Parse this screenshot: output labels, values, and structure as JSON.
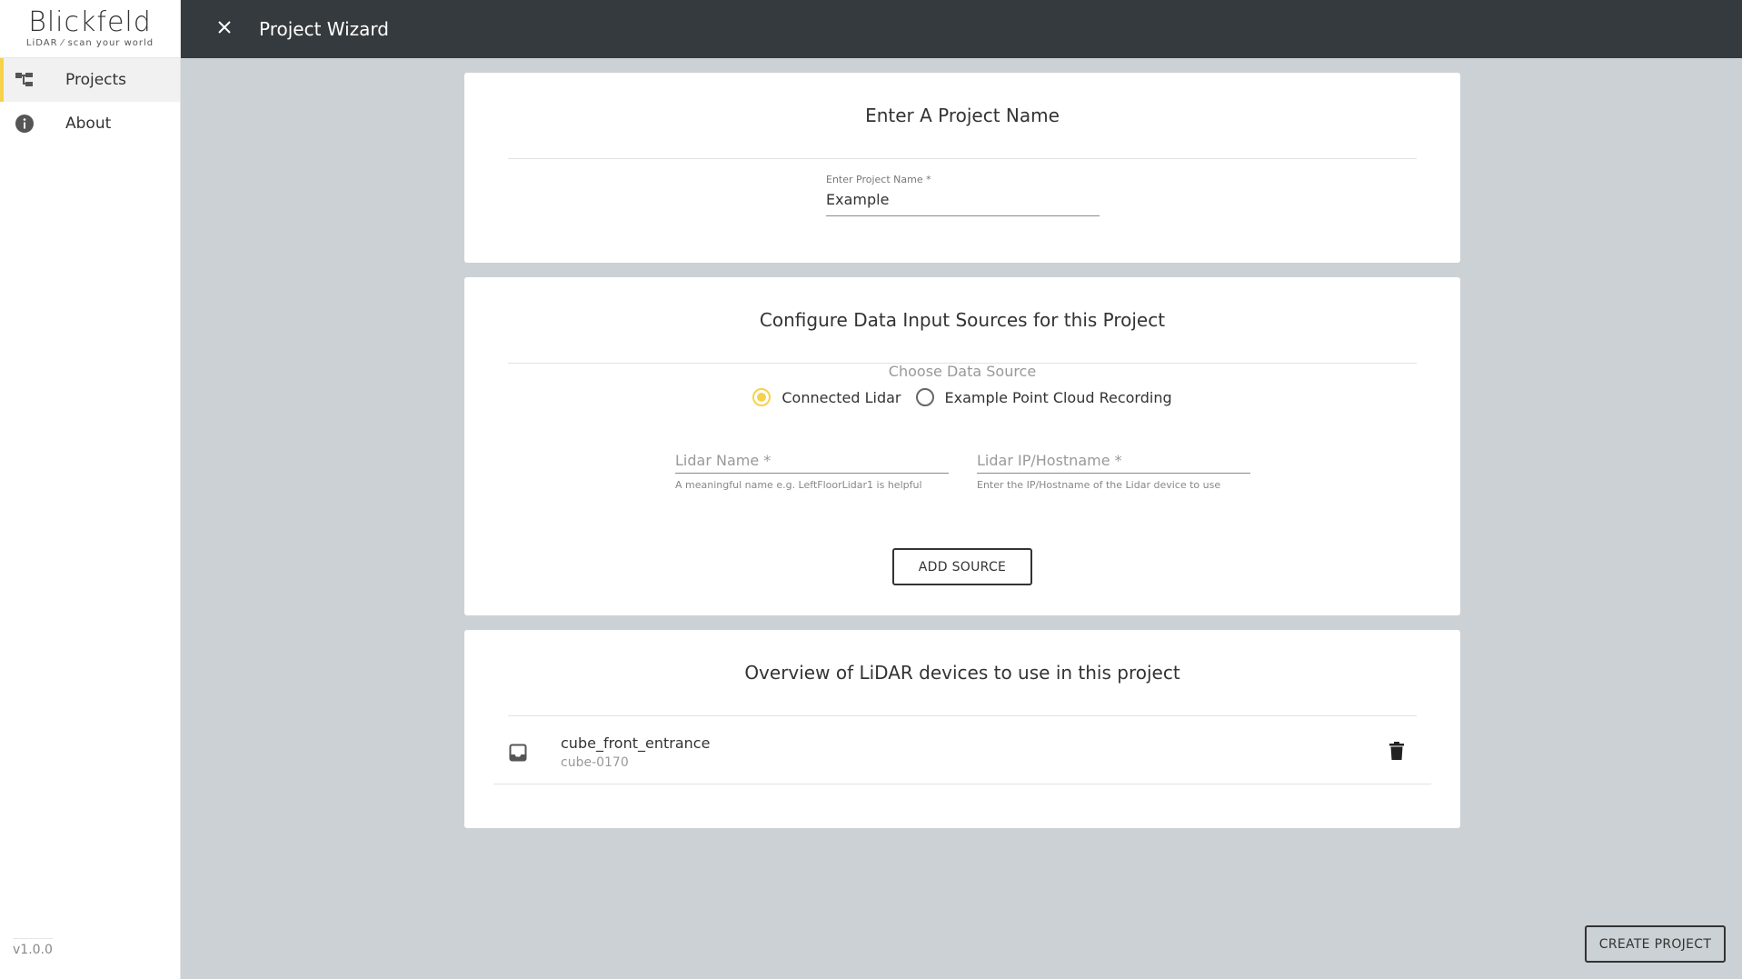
{
  "logo": {
    "word": "Blickfeld",
    "tagline": "LiDAR ⁄ scan your world"
  },
  "sidebar": {
    "items": [
      {
        "label": "Projects",
        "icon": "project-tree-icon",
        "active": true
      },
      {
        "label": "About",
        "icon": "info-icon",
        "active": false
      }
    ],
    "version": "v1.0.0"
  },
  "header": {
    "title": "Project Wizard",
    "close_icon": "close-icon"
  },
  "project_name": {
    "title": "Enter A Project Name",
    "label": "Enter Project Name *",
    "value": "Example"
  },
  "data_sources": {
    "title": "Configure Data Input Sources for this Project",
    "choose_label": "Choose Data Source",
    "options": [
      {
        "label": "Connected Lidar",
        "checked": true
      },
      {
        "label": "Example Point Cloud Recording",
        "checked": false
      }
    ],
    "lidar_name": {
      "placeholder": "Lidar Name *",
      "helper": "A meaningful name e.g. LeftFloorLidar1 is helpful"
    },
    "lidar_ip": {
      "placeholder": "Lidar IP/Hostname *",
      "helper": "Enter the IP/Hostname of the Lidar device to use"
    },
    "add_button": "ADD SOURCE"
  },
  "overview": {
    "title": "Overview of LiDAR devices to use in this project",
    "devices": [
      {
        "name": "cube_front_entrance",
        "id": "cube-0170",
        "icon": "inbox-icon",
        "action_icon": "trash-icon"
      }
    ]
  },
  "footer": {
    "create_button": "CREATE PROJECT"
  },
  "colors": {
    "accent": "#f6d24a",
    "topbar": "#353a3e",
    "background": "#ccd1d5"
  }
}
